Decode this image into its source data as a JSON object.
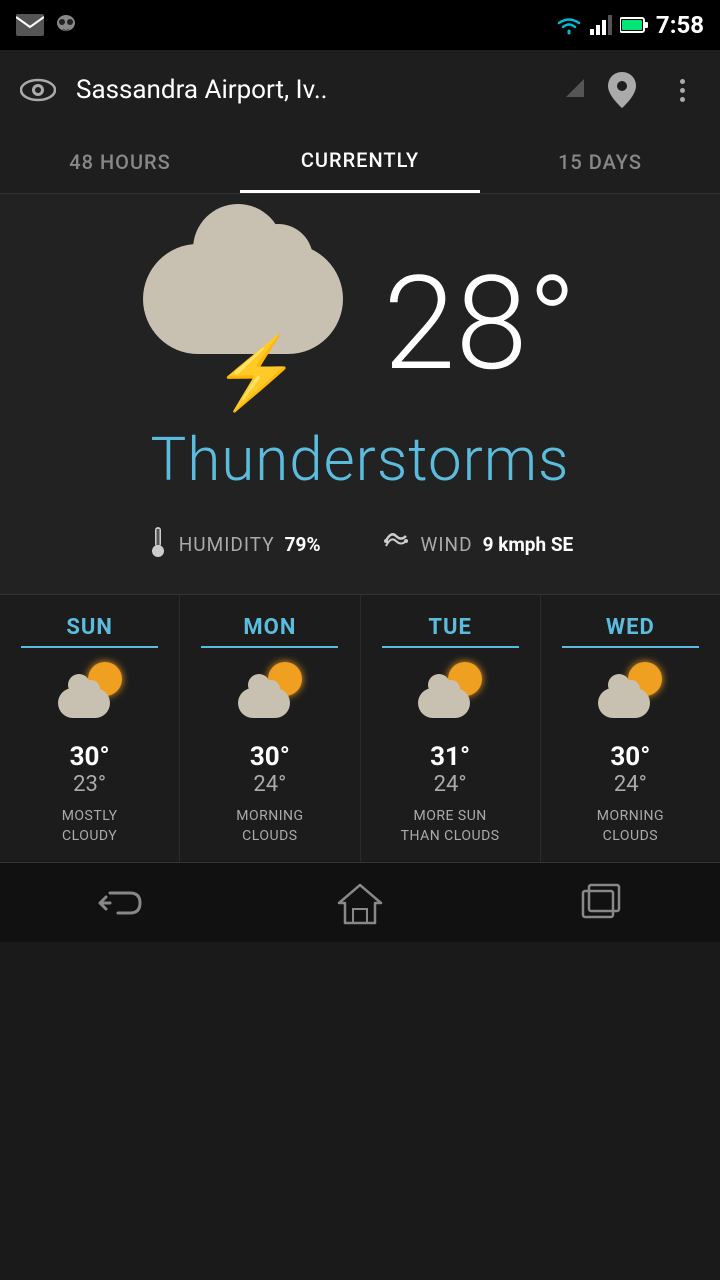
{
  "statusBar": {
    "time": "7:58",
    "icons": [
      "gmail",
      "alien",
      "wifi",
      "signal",
      "battery"
    ]
  },
  "topBar": {
    "title": "Sassandra Airport, Iv..",
    "eyeIcon": "👁",
    "pinIcon": "📍",
    "moreIcon": "⋮"
  },
  "tabs": [
    {
      "id": "48hours",
      "label": "48 HOURS",
      "active": false
    },
    {
      "id": "currently",
      "label": "CURRENTLY",
      "active": true
    },
    {
      "id": "15days",
      "label": "15 DAYS",
      "active": false
    }
  ],
  "currentWeather": {
    "temperature": "28°",
    "condition": "Thunderstorms",
    "humidity": {
      "label": "HUMIDITY",
      "value": "79%"
    },
    "wind": {
      "label": "WIND",
      "value": "9 kmph SE"
    }
  },
  "forecast": [
    {
      "day": "SUN",
      "high": "30°",
      "low": "23°",
      "description": "MOSTLY\nCLOUDY"
    },
    {
      "day": "MON",
      "high": "30°",
      "low": "24°",
      "description": "MORNING\nCLOUDS"
    },
    {
      "day": "TUE",
      "high": "31°",
      "low": "24°",
      "description": "MORE SUN\nTHAN CLOUDS"
    },
    {
      "day": "WED",
      "high": "30°",
      "low": "24°",
      "description": "MORNING\nCLOUDS"
    }
  ],
  "colors": {
    "accent": "#5bbcdd",
    "background": "#222222",
    "text": "#ffffff",
    "muted": "#aaaaaa",
    "lightning": "#f0a020"
  }
}
